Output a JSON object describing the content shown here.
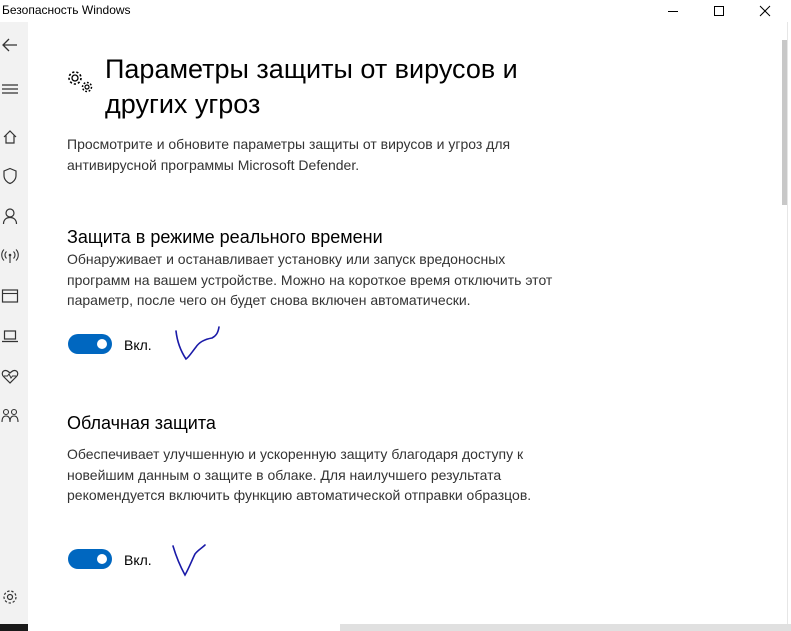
{
  "window": {
    "title": "Безопасность Windows"
  },
  "page": {
    "title": "Параметры защиты от вирусов и других угроз",
    "description": "Просмотрите и обновите параметры защиты от вирусов и угроз для антивирусной программы Microsoft Defender."
  },
  "sections": [
    {
      "title": "Защита в режиме реального времени",
      "description": "Обнаруживает и останавливает установку или запуск вредоносных программ на вашем устройстве. Можно на короткое время отключить этот параметр, после чего он будет снова включен автоматически.",
      "toggle_label": "Вкл.",
      "toggle_on": true
    },
    {
      "title": "Облачная защита",
      "description": "Обеспечивает улучшенную и ускоренную защиту благодаря доступу к новейшим данным о защите в облаке. Для наилучшего результата рекомендуется включить функцию автоматической отправки образцов.",
      "toggle_label": "Вкл.",
      "toggle_on": true
    }
  ],
  "sidebar": {
    "icons": [
      "back-arrow-icon",
      "menu-icon",
      "home-icon",
      "shield-icon",
      "person-icon",
      "wireless-icon",
      "browser-icon",
      "laptop-icon",
      "heart-pulse-icon",
      "family-icon",
      "settings-gear-icon"
    ]
  },
  "colors": {
    "accent": "#0067c0",
    "sidebar_bg": "#f2f2f2",
    "annotation": "#1a1aa8"
  }
}
